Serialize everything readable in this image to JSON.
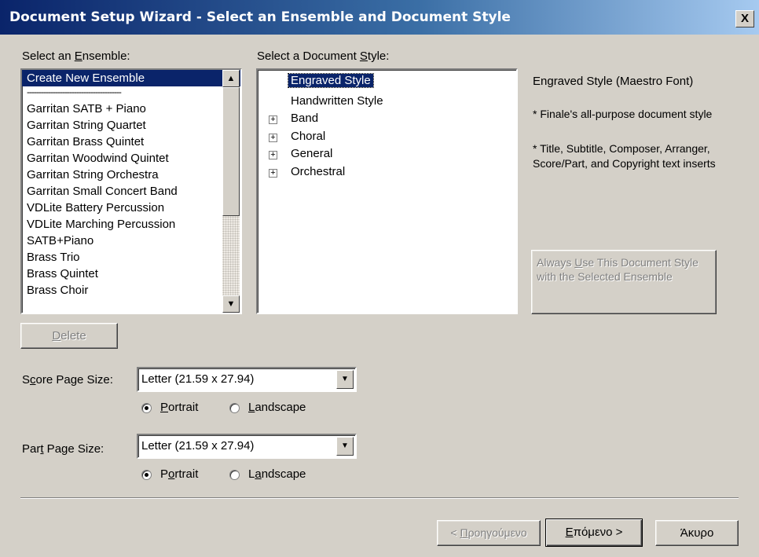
{
  "window": {
    "title": "Document Setup Wizard - Select an Ensemble and Document Style",
    "close_glyph": "X"
  },
  "ensemble": {
    "label_pre": "Select an ",
    "label_key": "E",
    "label_post": "nsemble:",
    "items": [
      "Create New Ensemble",
      "----------------------------------------",
      "Garritan SATB + Piano",
      "Garritan String Quartet",
      "Garritan Brass Quintet",
      "Garritan Woodwind Quintet",
      "Garritan String Orchestra",
      "Garritan Small Concert Band",
      "VDLite Battery Percussion",
      "VDLite Marching Percussion",
      "SATB+Piano",
      "Brass Trio",
      "Brass Quintet",
      "Brass Choir"
    ],
    "selected_index": 0,
    "delete_pre": "",
    "delete_key": "D",
    "delete_post": "elete"
  },
  "style": {
    "label_pre": "Select a Document ",
    "label_key": "S",
    "label_post": "tyle:",
    "items": [
      {
        "label": "Engraved Style",
        "expandable": false,
        "selected": true
      },
      {
        "label": "Handwritten Style",
        "expandable": false,
        "selected": false
      },
      {
        "label": "Band",
        "expandable": true,
        "selected": false
      },
      {
        "label": "Choral",
        "expandable": true,
        "selected": false
      },
      {
        "label": "General",
        "expandable": true,
        "selected": false
      },
      {
        "label": "Orchestral",
        "expandable": true,
        "selected": false
      }
    ],
    "description": {
      "heading": "Engraved Style (Maestro Font)",
      "line1": "* Finale's all-purpose document style",
      "line2": "* Title, Subtitle, Composer, Arranger, Score/Part, and Copyright text inserts"
    },
    "always_use_pre": "Always ",
    "always_use_key": "U",
    "always_use_post": "se This Document Style with the Selected Ensemble"
  },
  "score_page": {
    "label_pre": "S",
    "label_key": "c",
    "label_post": "ore Page Size:",
    "value": "Letter (21.59 x 27.94)",
    "portrait_pre": "",
    "portrait_key": "P",
    "portrait_post": "ortrait",
    "landscape_pre": "",
    "landscape_key": "L",
    "landscape_post": "andscape",
    "orientation": "portrait"
  },
  "part_page": {
    "label_pre": "Par",
    "label_key": "t",
    "label_post": " Page Size:",
    "value": "Letter (21.59 x 27.94)",
    "portrait_pre": "P",
    "portrait_key": "o",
    "portrait_post": "rtrait",
    "landscape_pre": "L",
    "landscape_key": "a",
    "landscape_post": "ndscape",
    "orientation": "portrait"
  },
  "footer": {
    "back_pre": "< ",
    "back_key": "Π",
    "back_post": "ροηγούμενο",
    "next_key": "Ε",
    "next_post": "πόμενο >",
    "cancel": "Άκυρο"
  }
}
